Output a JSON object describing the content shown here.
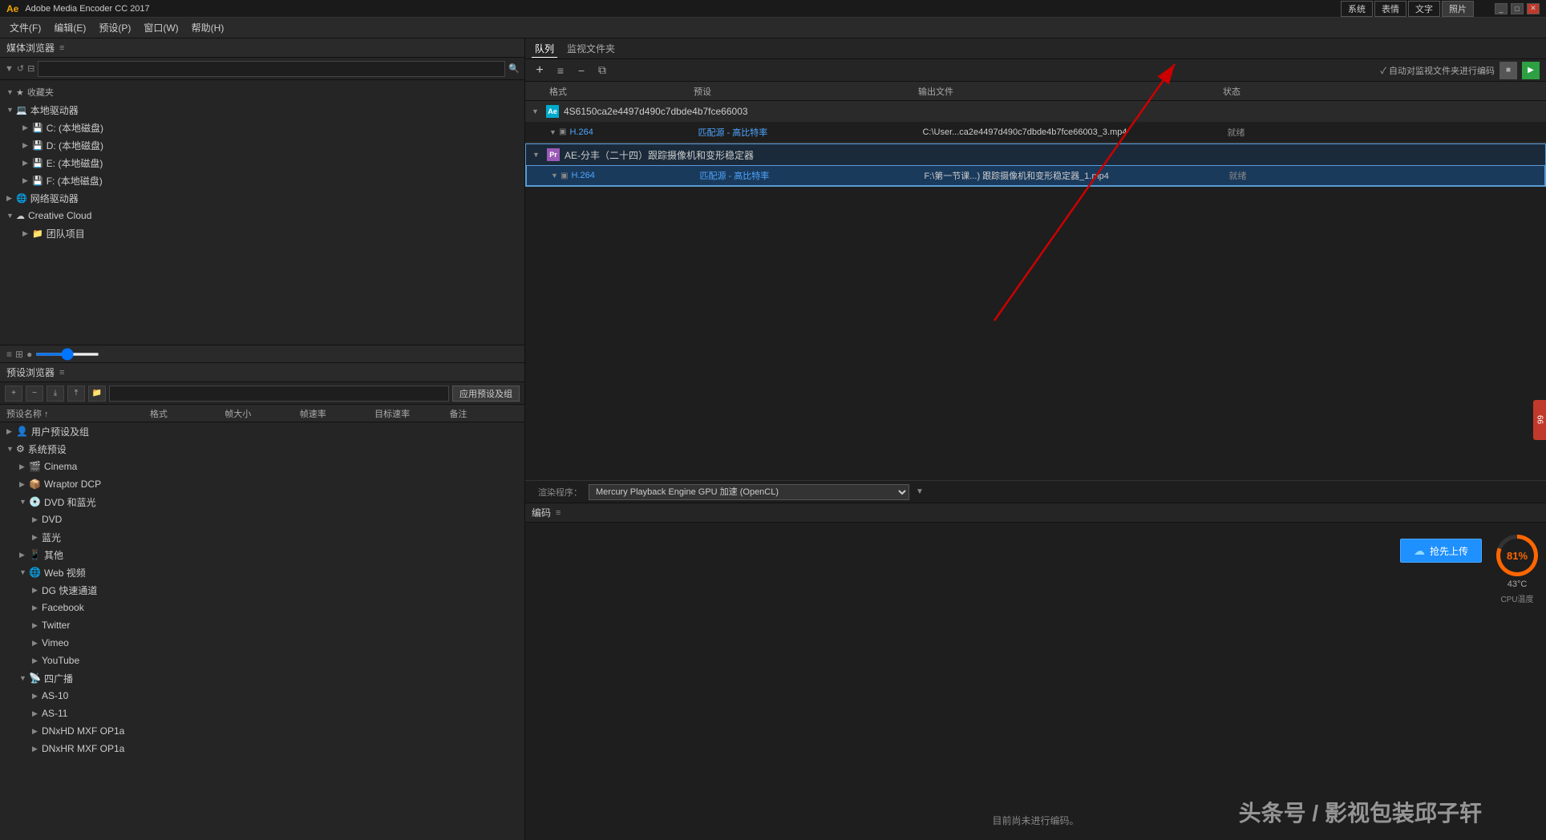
{
  "app": {
    "title": "Adobe Media Encoder CC 2017",
    "top_right_nav": [
      "系统",
      "表情",
      "文字",
      "照片"
    ]
  },
  "menu": {
    "items": [
      "文件(F)",
      "编辑(E)",
      "预设(P)",
      "窗口(W)",
      "帮助(H)"
    ]
  },
  "media_browser": {
    "title": "媒体浏览器",
    "menu_icon": "≡",
    "sections": {
      "favorites": {
        "label": "收藏夹"
      },
      "local_drives": {
        "label": "本地驱动器",
        "items": [
          "C: (本地磁盘)",
          "D: (本地磁盘)",
          "E: (本地磁盘)",
          "F: (本地磁盘)"
        ]
      },
      "network_drives": {
        "label": "网络驱动器"
      },
      "creative_cloud": {
        "label": "Creative Cloud",
        "items": [
          "团队项目"
        ]
      }
    }
  },
  "preset_browser": {
    "title": "预设浏览器",
    "menu_icon": "≡",
    "search_placeholder": "",
    "apply_btn": "应用预设及组",
    "columns": {
      "name": "预设名称 ↑",
      "format": "格式",
      "frame_size": "帧大小",
      "frame_rate": "帧速率",
      "target_rate": "目标速率",
      "notes": "备注"
    },
    "tree": {
      "user_presets": "用户预设及组",
      "system_presets": {
        "label": "系统预设",
        "items": {
          "cinema": "Cinema",
          "wraptor": "Wraptor DCP",
          "dvd_blu": {
            "label": "DVD 和蓝光",
            "items": [
              "DVD",
              "蓝光"
            ]
          },
          "web": "其他",
          "web_video": {
            "label": "Web 视频",
            "items": [
              "DG 快速通道",
              "Facebook",
              "Twitter",
              "Vimeo",
              "YouTube"
            ]
          },
          "broadcast": {
            "label": "四广播",
            "items": [
              "AS-10",
              "AS-11",
              "DNxHD MXF OP1a",
              "DNxHR MXF OP1a"
            ]
          }
        }
      }
    }
  },
  "queue": {
    "tabs": [
      "队列",
      "监视文件夹"
    ],
    "active_tab": "队列",
    "toolbar": {
      "add": "+",
      "menu": "≡",
      "remove": "−",
      "duplicate": "⧉",
      "auto_encode_label": "✓ 自动对监视文件夹进行编码",
      "stop_btn": "■",
      "start_btn": "▶"
    },
    "columns": {
      "format": "格式",
      "preset": "预设",
      "output": "输出文件",
      "status": "状态"
    },
    "groups": [
      {
        "id": "group1",
        "icon_type": "ae",
        "icon_label": "Ae",
        "name": "4S6150ca2e4497d490c7dbde4b7fce66003",
        "items": [
          {
            "format": "H.264",
            "preset": "匹配源 - 高比特率",
            "output": "C:\\User...ca2e4497d490c7dbde4b7fce66003_3.mp4",
            "status": "就绪"
          }
        ]
      },
      {
        "id": "group2",
        "icon_type": "ae",
        "icon_label": "Pr",
        "name": "AE-分丰（二十四）跟踪摄像机和变形稳定器",
        "selected": true,
        "items": [
          {
            "format": "H.264",
            "preset": "匹配源 - 高比特率",
            "output": "F:\\第一节课...)  跟踪摄像机和变形稳定器_1.mp4",
            "status": "就绪"
          }
        ]
      }
    ]
  },
  "render_engine": {
    "label": "渲染程序：",
    "value": "Mercury Playback Engine GPU 加速 (OpenCL)"
  },
  "encode": {
    "title": "编码",
    "menu_icon": "≡",
    "no_encoding_text": "目前尚未进行编码。",
    "upload_btn": "抢先上传",
    "cpu_percent": "81%",
    "cpu_temp": "43°C",
    "cpu_label": "CPU温度"
  },
  "watermark": "头条号 / 影视包装邱子轩",
  "side_btn": "66"
}
